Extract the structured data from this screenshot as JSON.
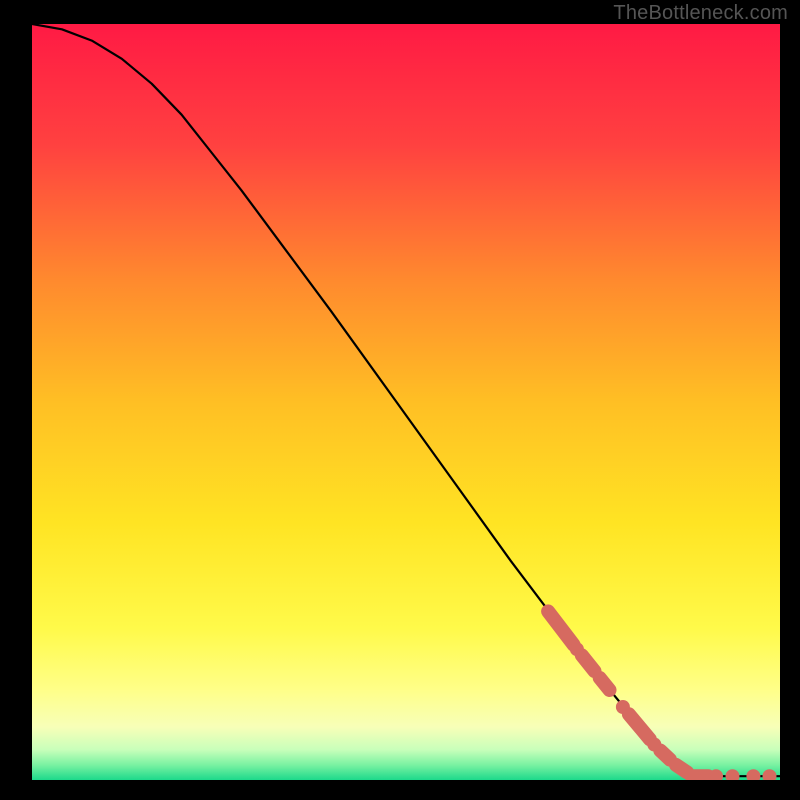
{
  "watermark": "TheBottleneck.com",
  "chart_data": {
    "type": "line",
    "title": "",
    "xlabel": "",
    "ylabel": "",
    "xlim": [
      0,
      100
    ],
    "ylim": [
      0,
      100
    ],
    "background": "rainbow-gradient-red-yellow-green",
    "series": [
      {
        "name": "curve",
        "style": "solid-black",
        "points": [
          {
            "x": 0,
            "y": 100
          },
          {
            "x": 4,
            "y": 99.3
          },
          {
            "x": 8,
            "y": 97.8
          },
          {
            "x": 12,
            "y": 95.4
          },
          {
            "x": 16,
            "y": 92.1
          },
          {
            "x": 20,
            "y": 88.0
          },
          {
            "x": 24,
            "y": 83.0
          },
          {
            "x": 28,
            "y": 78.0
          },
          {
            "x": 34,
            "y": 70.0
          },
          {
            "x": 40,
            "y": 62.0
          },
          {
            "x": 48,
            "y": 51.0
          },
          {
            "x": 56,
            "y": 40.0
          },
          {
            "x": 64,
            "y": 29.0
          },
          {
            "x": 72,
            "y": 18.5
          },
          {
            "x": 78,
            "y": 11.0
          },
          {
            "x": 82,
            "y": 6.2
          },
          {
            "x": 85,
            "y": 3.2
          },
          {
            "x": 87,
            "y": 1.6
          },
          {
            "x": 89,
            "y": 0.8
          },
          {
            "x": 92,
            "y": 0.5
          },
          {
            "x": 96,
            "y": 0.5
          },
          {
            "x": 100,
            "y": 0.5
          }
        ]
      },
      {
        "name": "highlight-segments",
        "style": "dashed-salmon",
        "segments": [
          {
            "x1": 69,
            "y1": 22.3,
            "x2": 72.4,
            "y2": 17.9
          },
          {
            "x1": 72.7,
            "y1": 17.5,
            "x2": 73.0,
            "y2": 17.1
          },
          {
            "x1": 73.5,
            "y1": 16.5,
            "x2": 75.2,
            "y2": 14.4
          },
          {
            "x1": 75.9,
            "y1": 13.5,
            "x2": 77.2,
            "y2": 11.9
          },
          {
            "x1": 78.8,
            "y1": 9.9,
            "x2": 79.2,
            "y2": 9.4
          },
          {
            "x1": 79.8,
            "y1": 8.7,
            "x2": 82.6,
            "y2": 5.4
          },
          {
            "x1": 83.0,
            "y1": 4.9,
            "x2": 83.4,
            "y2": 4.5
          },
          {
            "x1": 84.0,
            "y1": 3.9,
            "x2": 85.3,
            "y2": 2.7
          },
          {
            "x1": 86.1,
            "y1": 2.0,
            "x2": 87.6,
            "y2": 1.0
          },
          {
            "x1": 88.2,
            "y1": 0.5,
            "x2": 90.4,
            "y2": 0.5
          },
          {
            "x1": 90.9,
            "y1": 0.5,
            "x2": 92.0,
            "y2": 0.5
          },
          {
            "x1": 93.4,
            "y1": 0.5,
            "x2": 93.9,
            "y2": 0.5
          },
          {
            "x1": 96.2,
            "y1": 0.5,
            "x2": 96.7,
            "y2": 0.5
          },
          {
            "x1": 98.3,
            "y1": 0.5,
            "x2": 98.9,
            "y2": 0.5
          }
        ]
      }
    ]
  }
}
